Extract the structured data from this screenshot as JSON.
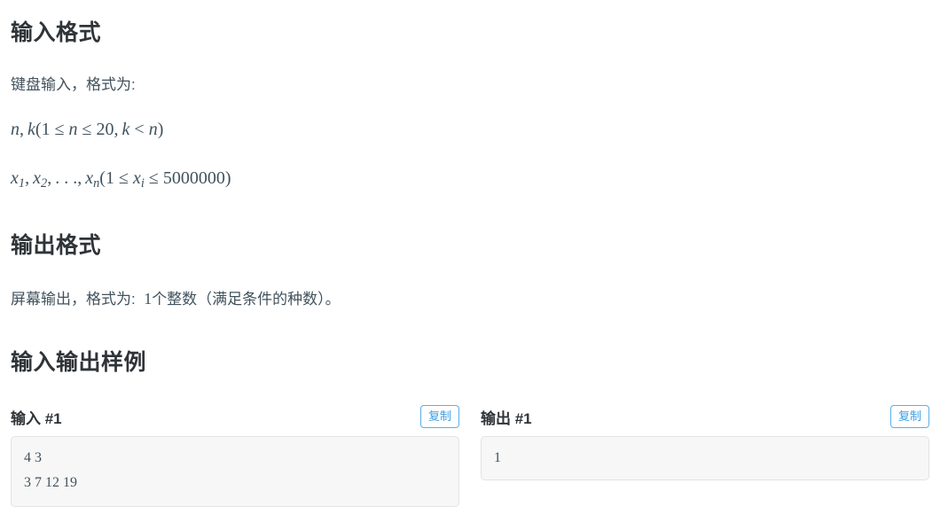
{
  "sections": {
    "input_format": {
      "heading": "输入格式",
      "paragraph": "键盘输入，格式为:",
      "formulas": [
        {
          "plain": "n, k(1 ≤ n ≤ 20, k < n)",
          "tokens": [
            "n",
            ",",
            "k",
            "(",
            "1",
            "≤",
            "n",
            "≤",
            "20",
            ",",
            "k",
            "<",
            "n",
            ")"
          ]
        },
        {
          "plain": "x1, x2, . . . , xn(1 ≤ xi ≤ 5000000)",
          "tokens": [
            "x",
            "1",
            ",",
            "x",
            "2",
            ",",
            ". . .",
            ",",
            "x",
            "n",
            "(",
            "1",
            "≤",
            "x",
            "i",
            "≤",
            "5000000",
            ")"
          ]
        }
      ]
    },
    "output_format": {
      "heading": "输出格式",
      "paragraph_before": "屏幕输出，格式为:",
      "paragraph_number": "1",
      "paragraph_after": "个整数（满足条件的种数）。"
    },
    "samples": {
      "heading": "输入输出样例",
      "items": [
        {
          "title": "输入 #1",
          "copy_label": "复制",
          "content": "4 3\n3 7 12 19"
        },
        {
          "title": "输出 #1",
          "copy_label": "复制",
          "content": "1"
        }
      ]
    }
  },
  "colors": {
    "heading": "#2f3438",
    "body_text": "#41525d",
    "link_blue": "#3c9ee5",
    "code_background": "#f7f7f7",
    "code_border": "#e3e3e3",
    "page_background": "#ffffff"
  }
}
